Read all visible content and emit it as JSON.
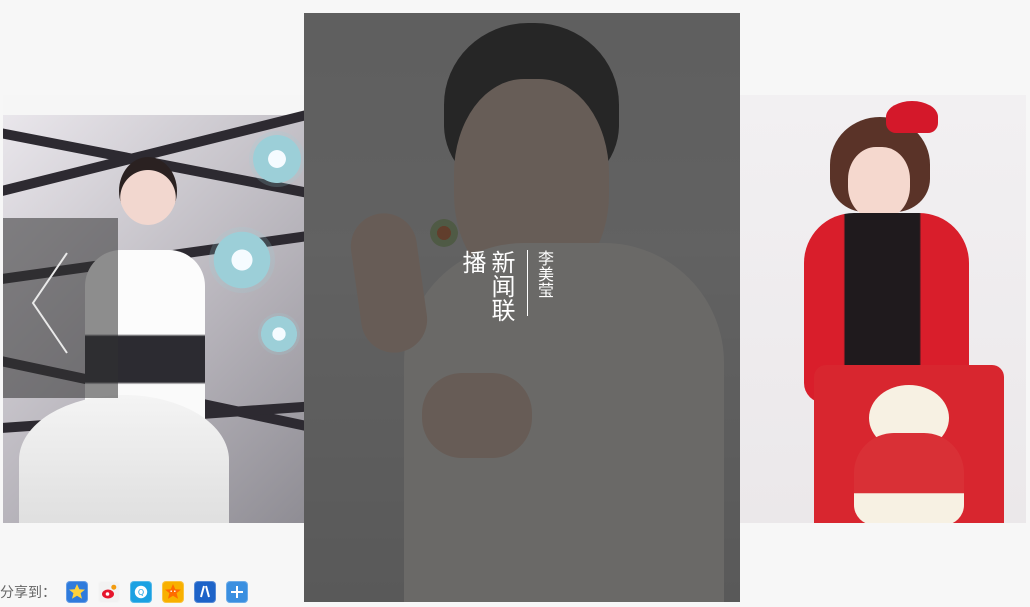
{
  "carousel": {
    "center": {
      "caption_title": "新闻联播",
      "caption_name": "李美莹"
    }
  },
  "share": {
    "label": "分享到：",
    "buttons": [
      {
        "name": "qzone-share-icon",
        "color": "#2f7bdc",
        "icon": "star"
      },
      {
        "name": "weibo-share-icon",
        "color": "#f2f2f2",
        "icon": "weibo"
      },
      {
        "name": "tencent-weibo-share-icon",
        "color": "#1ba1e2",
        "icon": "tencent"
      },
      {
        "name": "pengyou-share-icon",
        "color": "#f8b000",
        "icon": "star-face"
      },
      {
        "name": "renren-share-icon",
        "color": "#1d63c8",
        "icon": "person"
      },
      {
        "name": "more-share-icon",
        "color": "#3a8fe0",
        "icon": "plus"
      }
    ]
  }
}
